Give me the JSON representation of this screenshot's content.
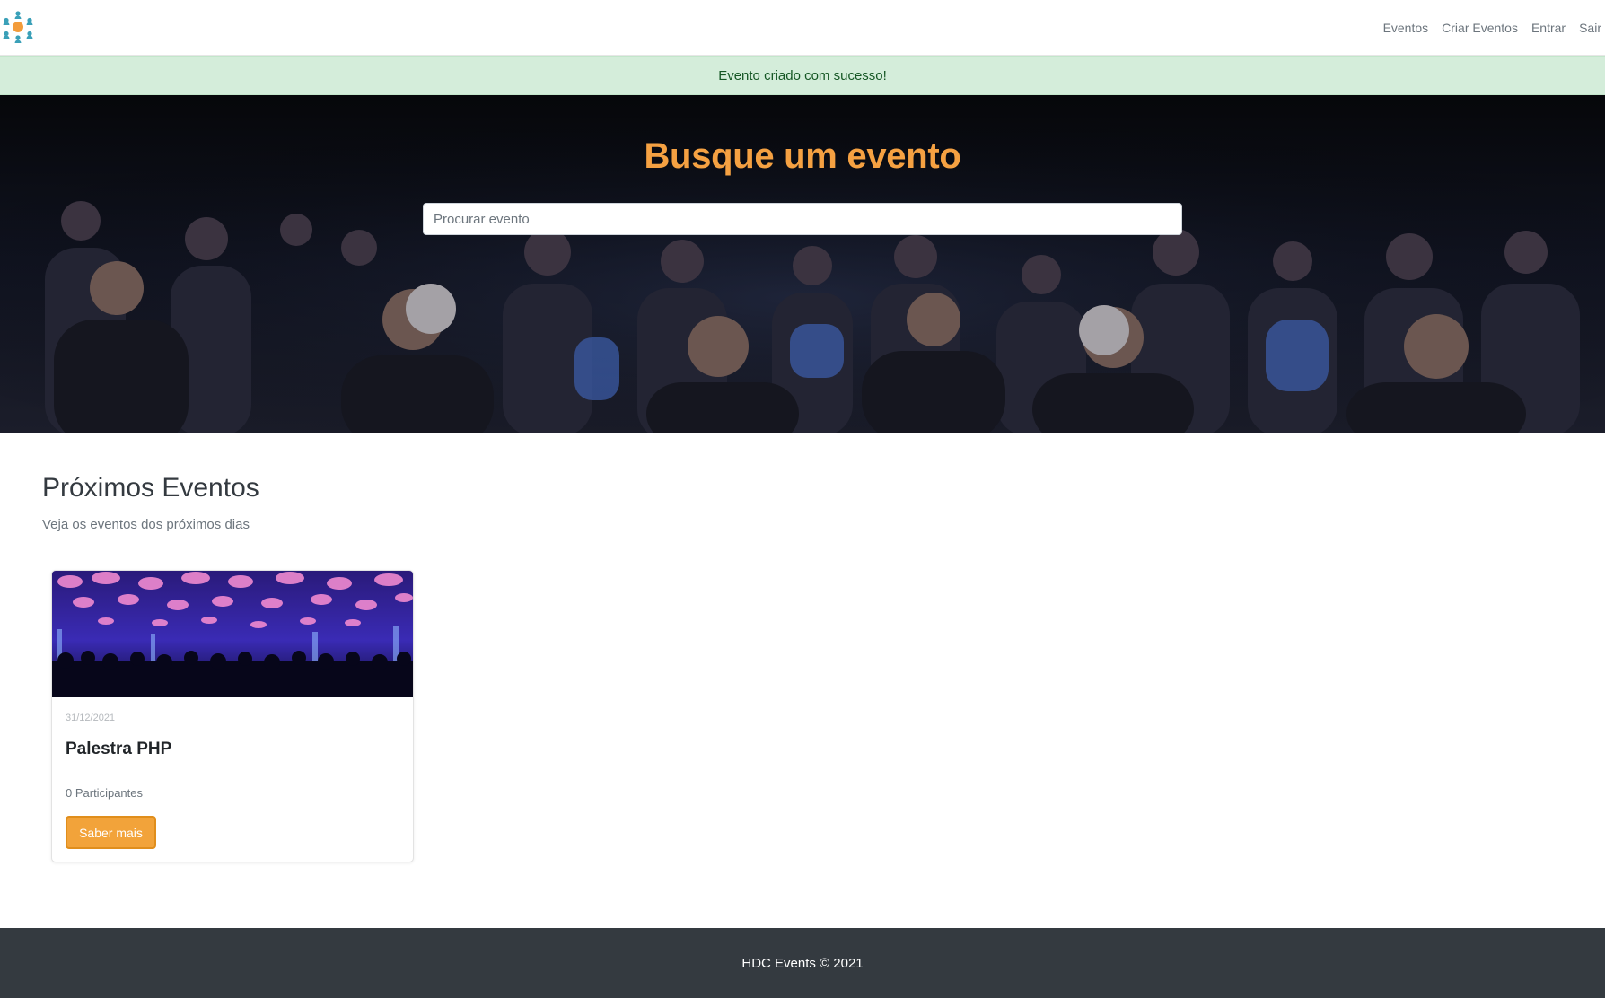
{
  "navbar": {
    "links": [
      "Eventos",
      "Criar Eventos",
      "Entrar",
      "Sair"
    ]
  },
  "alert": {
    "message": "Evento criado com sucesso!"
  },
  "hero": {
    "title": "Busque um evento",
    "search_placeholder": "Procurar evento"
  },
  "events": {
    "title": "Próximos Eventos",
    "subtitle": "Veja os eventos dos próximos dias",
    "items": [
      {
        "date": "31/12/2021",
        "title": "Palestra PHP",
        "participants": "0 Participantes",
        "button_label": "Saber mais"
      }
    ]
  },
  "footer": {
    "text": "HDC Events © 2021"
  },
  "colors": {
    "accent": "#f5a142",
    "alert_bg": "#d4edda",
    "alert_text": "#155724",
    "footer_bg": "#343a40",
    "button_bg": "#f2a33a"
  },
  "icons": {
    "logo": "people-network-logo-icon"
  }
}
